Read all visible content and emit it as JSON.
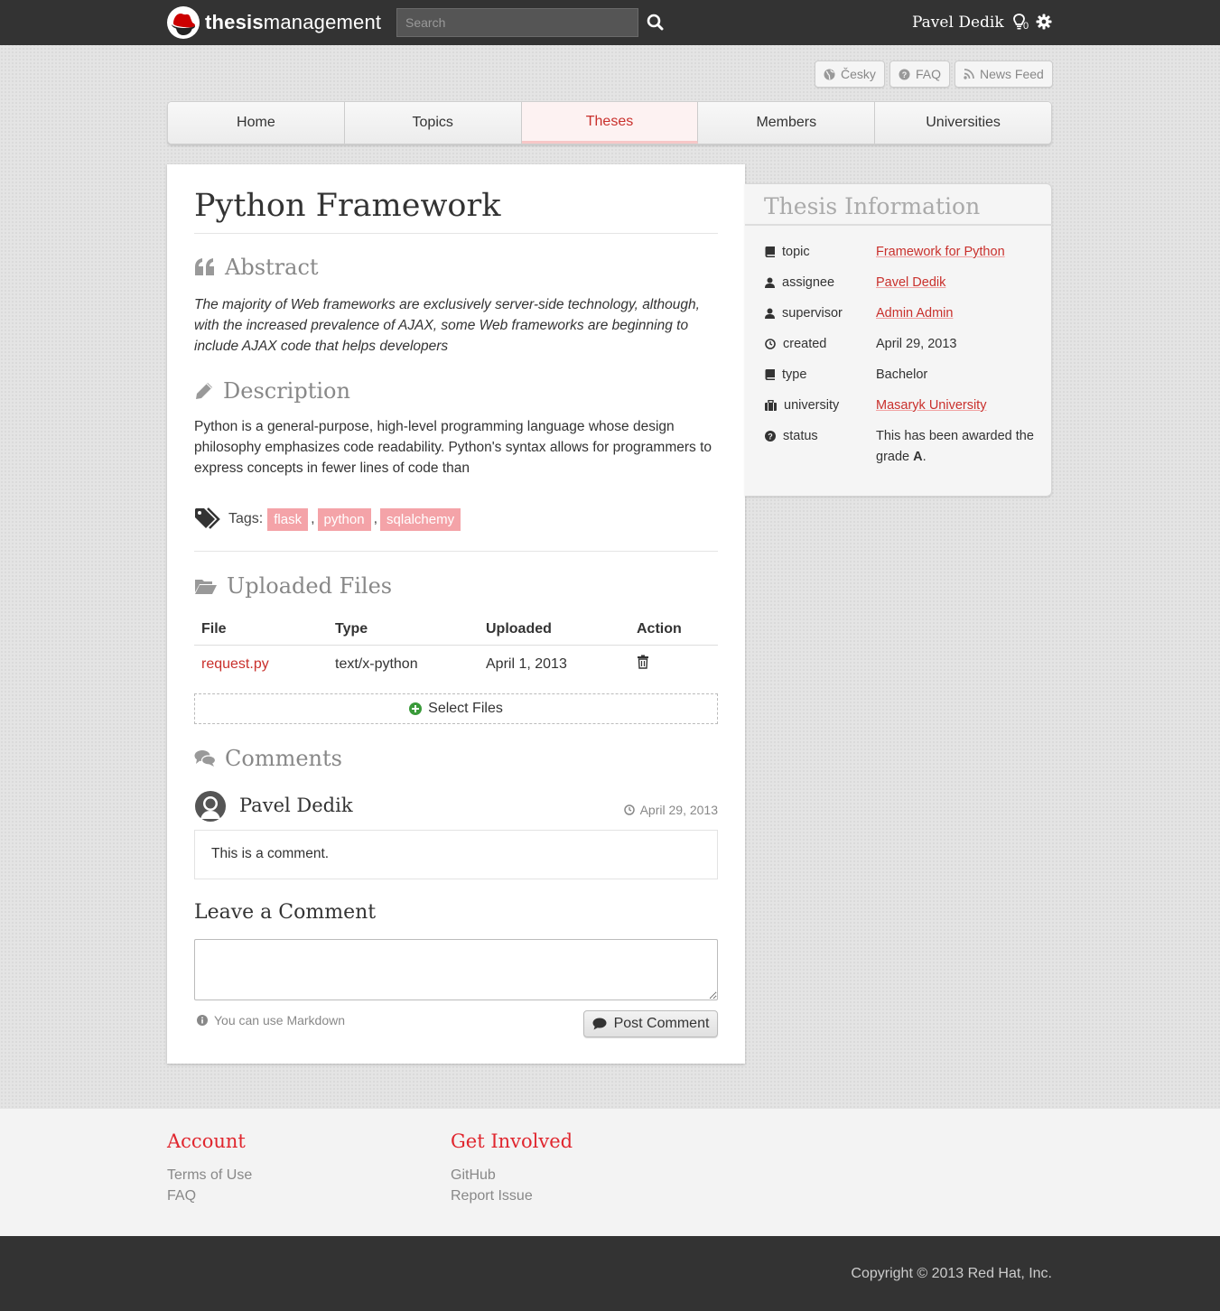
{
  "topbar": {
    "brand_bold": "thesis",
    "brand_light": "management",
    "search_placeholder": "Search",
    "username": "Pavel Dedik",
    "notification_count": "0"
  },
  "util": {
    "language": "Česky",
    "faq": "FAQ",
    "news_feed": "News Feed"
  },
  "nav": [
    "Home",
    "Topics",
    "Theses",
    "Members",
    "Universities"
  ],
  "nav_active": "Theses",
  "thesis": {
    "title": "Python Framework",
    "abstract_heading": "Abstract",
    "abstract": "The majority of Web frameworks are exclusively server-side technology, although, with the increased prevalence of AJAX, some Web frameworks are beginning to include AJAX code that helps developers",
    "description_heading": "Description",
    "description": "Python is a general-purpose, high-level programming language whose design philosophy emphasizes code readability. Python's syntax allows for programmers to express concepts in fewer lines of code than",
    "tags_label": "Tags:",
    "tags": [
      "flask",
      "python",
      "sqlalchemy"
    ],
    "tag_separator": ","
  },
  "files": {
    "heading": "Uploaded Files",
    "columns": [
      "File",
      "Type",
      "Uploaded",
      "Action"
    ],
    "rows": [
      {
        "file": "request.py",
        "type": "text/x-python",
        "uploaded": "April 1, 2013"
      }
    ],
    "select_label": "Select Files"
  },
  "comments": {
    "heading": "Comments",
    "items": [
      {
        "author": "Pavel Dedik",
        "date": "April 29, 2013",
        "text": "This is a comment."
      }
    ],
    "leave_heading": "Leave a Comment",
    "markdown_hint": "You can use Markdown",
    "post_label": "Post Comment"
  },
  "sidebar": {
    "heading": "Thesis Information",
    "rows": [
      {
        "icon": "book-icon",
        "key": "topic",
        "value": "Framework for Python",
        "link": true
      },
      {
        "icon": "user-icon",
        "key": "assignee",
        "value": "Pavel Dedik",
        "link": true
      },
      {
        "icon": "user-icon",
        "key": "supervisor",
        "value": "Admin Admin",
        "link": true
      },
      {
        "icon": "clock-icon",
        "key": "created",
        "value": "April 29, 2013",
        "link": false
      },
      {
        "icon": "book-icon",
        "key": "type",
        "value": "Bachelor",
        "link": false
      },
      {
        "icon": "briefcase-icon",
        "key": "university",
        "value": "Masaryk University",
        "link": true
      },
      {
        "icon": "question-icon",
        "key": "status",
        "value_prefix": "This has been awarded the grade ",
        "value_grade": "A",
        "value_suffix": ".",
        "link": false
      }
    ]
  },
  "footer": {
    "account_heading": "Account",
    "account_links": [
      "Terms of Use",
      "FAQ"
    ],
    "involved_heading": "Get Involved",
    "involved_links": [
      "GitHub",
      "Report Issue"
    ],
    "copyright": "Copyright © 2013 Red Hat, Inc."
  },
  "colors": {
    "accent": "#c9302c",
    "footer_heading": "#e0262e",
    "tag_bg": "#f4a3a8",
    "topbar": "#333333"
  }
}
